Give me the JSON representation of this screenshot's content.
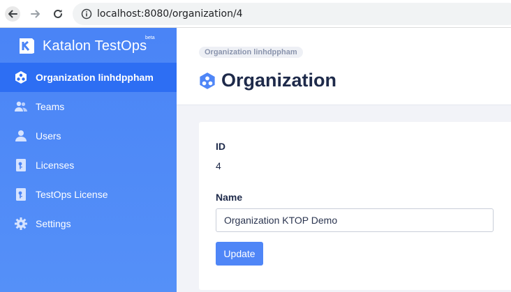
{
  "browser": {
    "url": "localhost:8080/organization/4"
  },
  "sidebar": {
    "brand_name": "Katalon TestOps",
    "brand_badge": "beta",
    "items": [
      {
        "label": "Organization linhdppham",
        "icon": "organization-icon",
        "active": true
      },
      {
        "label": "Teams",
        "icon": "teams-icon",
        "active": false
      },
      {
        "label": "Users",
        "icon": "user-icon",
        "active": false
      },
      {
        "label": "Licenses",
        "icon": "license-icon",
        "active": false
      },
      {
        "label": "TestOps License",
        "icon": "license-icon",
        "active": false
      },
      {
        "label": "Settings",
        "icon": "gear-icon",
        "active": false
      }
    ]
  },
  "header": {
    "breadcrumb": "Organization linhdppham",
    "title": "Organization"
  },
  "form": {
    "id_label": "ID",
    "id_value": "4",
    "name_label": "Name",
    "name_value": "Organization KTOP Demo",
    "update_label": "Update"
  },
  "colors": {
    "sidebar": "#4f86f7",
    "sidebar_active": "#2d6ef3",
    "title": "#1e2a4a",
    "button": "#4f86f7"
  }
}
